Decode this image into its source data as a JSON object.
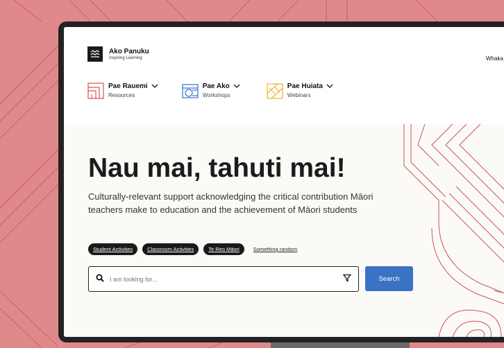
{
  "brand": {
    "name": "Ako Panuku",
    "tagline": "Inspiring Learning"
  },
  "header": {
    "top_link": "Whaka"
  },
  "nav": [
    {
      "title": "Pae Rauemi",
      "subtitle": "Resources",
      "icon": "resources-icon",
      "color": "#d9534f"
    },
    {
      "title": "Pae Ako",
      "subtitle": "Workshops",
      "icon": "workshops-icon",
      "color": "#3a73c4"
    },
    {
      "title": "Pae Huiata",
      "subtitle": "Webinars",
      "icon": "webinars-icon",
      "color": "#f0b429"
    }
  ],
  "hero": {
    "title": "Nau mai, tahuti mai!",
    "description": "Culturally-relevant support acknowledging the critical contribution Māori teachers make to education and the achievement of Māori students",
    "tags": [
      "Student Activities",
      "Classroom Activities",
      "Te Reo Māori"
    ],
    "random_link": "Something random"
  },
  "search": {
    "placeholder": "I am looking for...",
    "button_label": "Search"
  },
  "colors": {
    "accent": "#3a73c4",
    "background": "#e0898a",
    "pattern": "#c0393d"
  }
}
